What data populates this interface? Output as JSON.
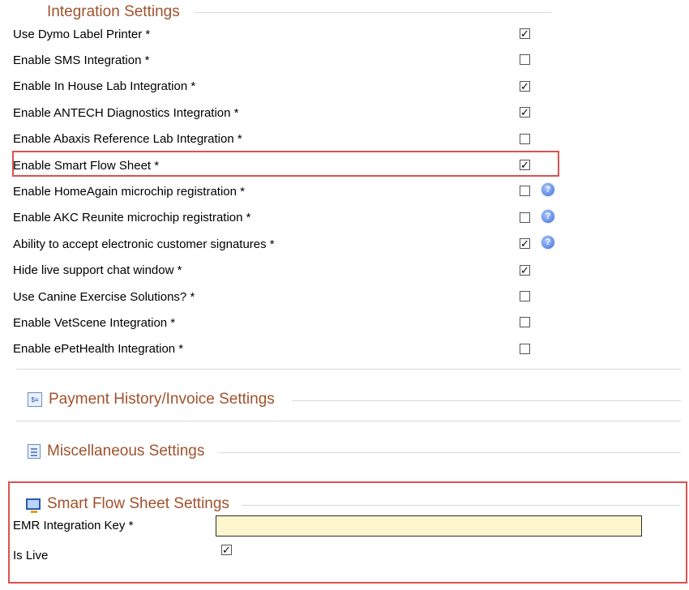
{
  "integration": {
    "title": "Integration Settings",
    "items": [
      {
        "label": "Use Dymo Label Printer *",
        "checked": true,
        "help": false
      },
      {
        "label": "Enable SMS Integration *",
        "checked": false,
        "help": false
      },
      {
        "label": "Enable In House Lab Integration *",
        "checked": true,
        "help": false
      },
      {
        "label": "Enable ANTECH Diagnostics Integration *",
        "checked": true,
        "help": false
      },
      {
        "label": "Enable Abaxis Reference Lab Integration *",
        "checked": false,
        "help": false
      },
      {
        "label": "Enable Smart Flow Sheet *",
        "checked": true,
        "help": false
      },
      {
        "label": "Enable HomeAgain microchip registration *",
        "checked": false,
        "help": true
      },
      {
        "label": "Enable AKC Reunite microchip registration *",
        "checked": false,
        "help": true
      },
      {
        "label": "Ability to accept electronic customer signatures *",
        "checked": true,
        "help": true
      },
      {
        "label": "Hide live support chat window *",
        "checked": true,
        "help": false
      },
      {
        "label": "Use Canine Exercise Solutions? *",
        "checked": false,
        "help": false
      },
      {
        "label": "Enable VetScene Integration *",
        "checked": false,
        "help": false
      },
      {
        "label": "Enable ePetHealth Integration *",
        "checked": false,
        "help": false
      }
    ]
  },
  "payment": {
    "title": "Payment History/Invoice Settings",
    "icon": "payment-icon"
  },
  "misc": {
    "title": "Miscellaneous Settings",
    "icon": "document-icon"
  },
  "smart_flow": {
    "title": "Smart Flow Sheet Settings",
    "icon": "monitor-icon",
    "emr_label": "EMR Integration Key *",
    "emr_value": "",
    "is_live_label": "Is Live",
    "is_live_checked": true
  },
  "colors": {
    "section_title": "#a0522d",
    "highlight": "#d9534f",
    "input_bg": "#fdf5cc",
    "help": "#3f6fd8"
  }
}
